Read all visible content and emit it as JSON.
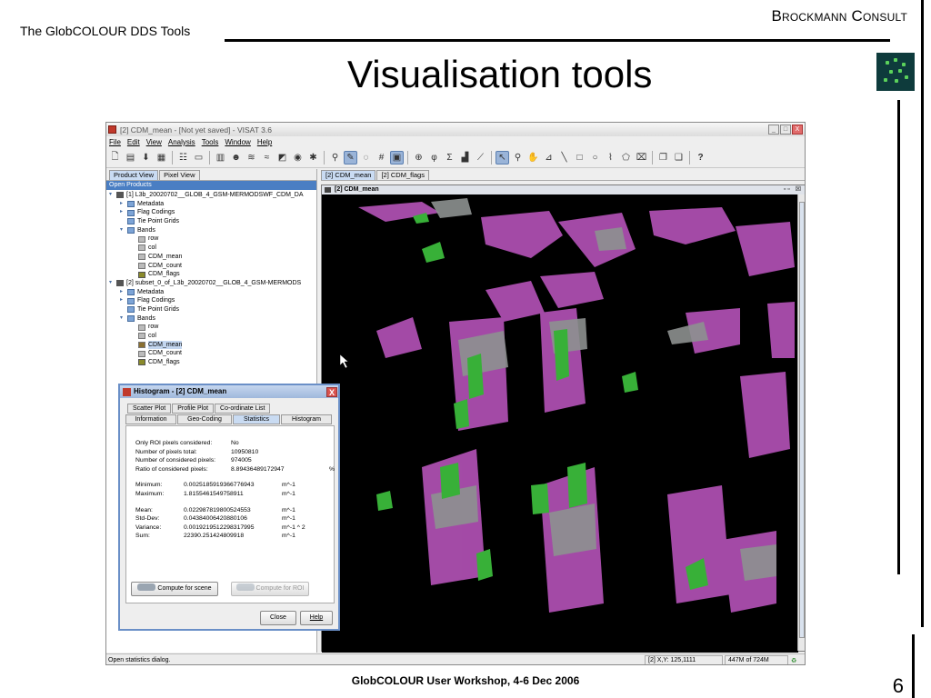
{
  "slide": {
    "header_left": "The GlobCOLOUR DDS Tools",
    "header_right": "Brockmann Consult",
    "title": "Visualisation tools",
    "footer": "GlobCOLOUR User Workshop, 4-6 Dec 2006",
    "page_number": "6"
  },
  "app": {
    "window_title": "[2] CDM_mean - [Not yet saved] - VISAT 3.6",
    "window_buttons": [
      "_",
      "□",
      "X"
    ],
    "menu": [
      "File",
      "Edit",
      "View",
      "Analysis",
      "Tools",
      "Window",
      "Help"
    ],
    "left_tabs": [
      "Product View",
      "Pixel View"
    ],
    "panel_title": "Open Products",
    "tree": [
      {
        "label": "[1] L3b_20020702__GLOB_4_GSM-MERMODSWF_CDM_DA",
        "icon": "product-icon",
        "level": 0,
        "toggle": "▾"
      },
      {
        "label": "Metadata",
        "icon": "folder-icon",
        "level": 1,
        "toggle": "▸"
      },
      {
        "label": "Flag Codings",
        "icon": "folder-icon",
        "level": 1,
        "toggle": "▸"
      },
      {
        "label": "Tie Point Grids",
        "icon": "folder-icon",
        "level": 1,
        "toggle": ""
      },
      {
        "label": "Bands",
        "icon": "folder-icon",
        "level": 1,
        "toggle": "▾"
      },
      {
        "label": "row",
        "icon": "band-icon",
        "level": 2,
        "toggle": ""
      },
      {
        "label": "col",
        "icon": "band-icon",
        "level": 2,
        "toggle": ""
      },
      {
        "label": "CDM_mean",
        "icon": "band-icon",
        "level": 2,
        "toggle": ""
      },
      {
        "label": "CDM_count",
        "icon": "band-icon",
        "level": 2,
        "toggle": ""
      },
      {
        "label": "CDM_flags",
        "icon": "flag-band-icon",
        "level": 2,
        "toggle": ""
      },
      {
        "label": "[2] subset_0_of_L3b_20020702__GLOB_4_GSM-MERMODS",
        "icon": "product-icon",
        "level": 0,
        "toggle": "▾"
      },
      {
        "label": "Metadata",
        "icon": "folder-icon",
        "level": 1,
        "toggle": "▸"
      },
      {
        "label": "Flag Codings",
        "icon": "folder-icon",
        "level": 1,
        "toggle": "▸"
      },
      {
        "label": "Tie Point Grids",
        "icon": "folder-icon",
        "level": 1,
        "toggle": ""
      },
      {
        "label": "Bands",
        "icon": "folder-icon",
        "level": 1,
        "toggle": "▾"
      },
      {
        "label": "row",
        "icon": "band-icon",
        "level": 2,
        "toggle": ""
      },
      {
        "label": "col",
        "icon": "band-icon",
        "level": 2,
        "toggle": ""
      },
      {
        "label": "CDM_mean",
        "icon": "band-icon",
        "level": 2,
        "toggle": "",
        "selected": true
      },
      {
        "label": "CDM_count",
        "icon": "band-icon",
        "level": 2,
        "toggle": ""
      },
      {
        "label": "CDM_flags",
        "icon": "flag-band-icon",
        "level": 2,
        "toggle": ""
      }
    ],
    "doc_tabs": [
      "[2] CDM_mean",
      "[2] CDM_flags"
    ],
    "image_frame_title": "[2] CDM_mean",
    "image_frame_controls": "▫▫ ☒",
    "status": {
      "message": "Open statistics dialog.",
      "coords": "[2] X,Y: 125,1111",
      "memory": "447M of 724M"
    },
    "colors": {
      "image_background": "#000000",
      "magenta": "#c65ac9",
      "green": "#3fae3a",
      "grey": "#8a8f8d"
    }
  },
  "dialog": {
    "title": "Histogram - [2] CDM_mean",
    "close": "X",
    "tabs_row1": [
      "Scatter Plot",
      "Profile Plot",
      "Co-ordinate List"
    ],
    "tabs_row2": [
      "Information",
      "Geo-Coding",
      "Statistics",
      "Histogram"
    ],
    "active_tab": "Statistics",
    "stats_block1": [
      {
        "label": "Only ROI pixels considered:",
        "value": "No",
        "unit": ""
      },
      {
        "label": "Number of pixels total:",
        "value": "10950810",
        "unit": ""
      },
      {
        "label": "Number of considered pixels:",
        "value": "974005",
        "unit": ""
      },
      {
        "label": "Ratio of considered pixels:",
        "value": "8.89436489172947",
        "unit": "%"
      }
    ],
    "stats_block2": [
      {
        "label": "Minimum:",
        "value": "0.0025185919366776943",
        "unit": "m^-1"
      },
      {
        "label": "Maximum:",
        "value": "1.8155461549758911",
        "unit": "m^-1"
      }
    ],
    "stats_block3": [
      {
        "label": "Mean:",
        "value": "0.022987819800524553",
        "unit": "m^-1"
      },
      {
        "label": "Std-Dev:",
        "value": "0.04384006420880106",
        "unit": "m^-1"
      },
      {
        "label": "Variance:",
        "value": "0.0019219512298317995",
        "unit": "m^-1 ^ 2"
      },
      {
        "label": "Sum:",
        "value": "22390.251424809918",
        "unit": "m^-1"
      }
    ],
    "buttons": {
      "compute_scene": "Compute for scene",
      "compute_roi": "Compute for ROI",
      "close": "Close",
      "help": "Help"
    }
  }
}
